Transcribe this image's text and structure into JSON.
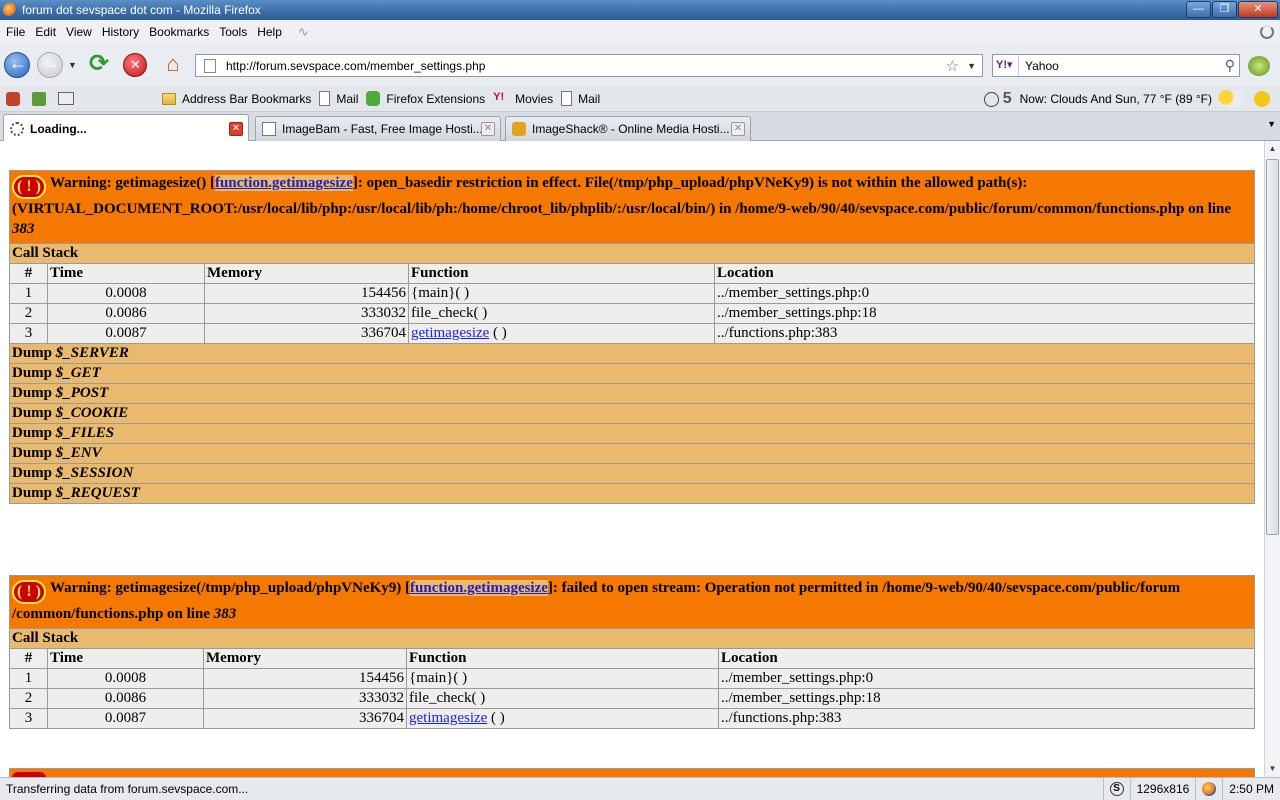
{
  "window": {
    "title": "forum dot sevspace dot com - Mozilla Firefox"
  },
  "menu": [
    "File",
    "Edit",
    "View",
    "History",
    "Bookmarks",
    "Tools",
    "Help"
  ],
  "nav": {
    "url": "http://forum.sevspace.com/member_settings.php",
    "search_value": "Yahoo"
  },
  "bookmarks": {
    "items": [
      "Address Bar Bookmarks",
      "Mail",
      "Firefox Extensions",
      "Movies",
      "Mail"
    ],
    "weather_count": "5",
    "weather_text": "Now: Clouds And Sun, 77 °F (89 °F)"
  },
  "tabs": [
    {
      "label": "Loading...",
      "active": true
    },
    {
      "label": "ImageBam - Fast, Free Image Hosti...",
      "active": false
    },
    {
      "label": "ImageShack® - Online Media Hosti...",
      "active": false
    }
  ],
  "errors": [
    {
      "prefix": "Warning: getimagesize() [",
      "link": "function.getimagesize",
      "message": "]: open_basedir restriction in effect. File(/tmp/php_upload/phpVNeKy9) is not within the allowed path(s): (VIRTUAL_DOCUMENT_ROOT:/usr/local/lib/php:/usr/local/lib/ph:/home/chroot_lib/phplib/:/usr/local/bin/) in /home/9-web/90/40/sevspace.com/public/forum/common/functions.php on line ",
      "line": "383",
      "call_stack_label": "Call Stack",
      "columns": [
        "#",
        "Time",
        "Memory",
        "Function",
        "Location"
      ],
      "rows": [
        {
          "n": "1",
          "time": "0.0008",
          "memory": "154456",
          "func": "{main}( )",
          "func_link": "",
          "loc": "../member_settings.php:0"
        },
        {
          "n": "2",
          "time": "0.0086",
          "memory": "333032",
          "func": "file_check( )",
          "func_link": "",
          "loc": "../member_settings.php:18"
        },
        {
          "n": "3",
          "time": "0.0087",
          "memory": "336704",
          "func": " ( )",
          "func_link": "getimagesize",
          "loc": "../functions.php:383"
        }
      ],
      "dumps": [
        "$_SERVER",
        "$_GET",
        "$_POST",
        "$_COOKIE",
        "$_FILES",
        "$_ENV",
        "$_SESSION",
        "$_REQUEST"
      ],
      "dump_label": "Dump"
    },
    {
      "prefix": "Warning: getimagesize(/tmp/php_upload/phpVNeKy9) [",
      "link": "function.getimagesize",
      "message": "]: failed to open stream: Operation not permitted in /home/9-web/90/40/sevspace.com/public/forum /common/functions.php on line ",
      "line": "383",
      "call_stack_label": "Call Stack",
      "columns": [
        "#",
        "Time",
        "Memory",
        "Function",
        "Location"
      ],
      "rows": [
        {
          "n": "1",
          "time": "0.0008",
          "memory": "154456",
          "func": "{main}( )",
          "func_link": "",
          "loc": "../member_settings.php:0"
        },
        {
          "n": "2",
          "time": "0.0086",
          "memory": "333032",
          "func": "file_check( )",
          "func_link": "",
          "loc": "../member_settings.php:18"
        },
        {
          "n": "3",
          "time": "0.0087",
          "memory": "336704",
          "func": " ( )",
          "func_link": "getimagesize",
          "loc": "../functions.php:383"
        }
      ]
    }
  ],
  "status": {
    "text": "Transferring data from forum.sevspace.com...",
    "resolution": "1296x816",
    "time": "2:50 PM"
  }
}
